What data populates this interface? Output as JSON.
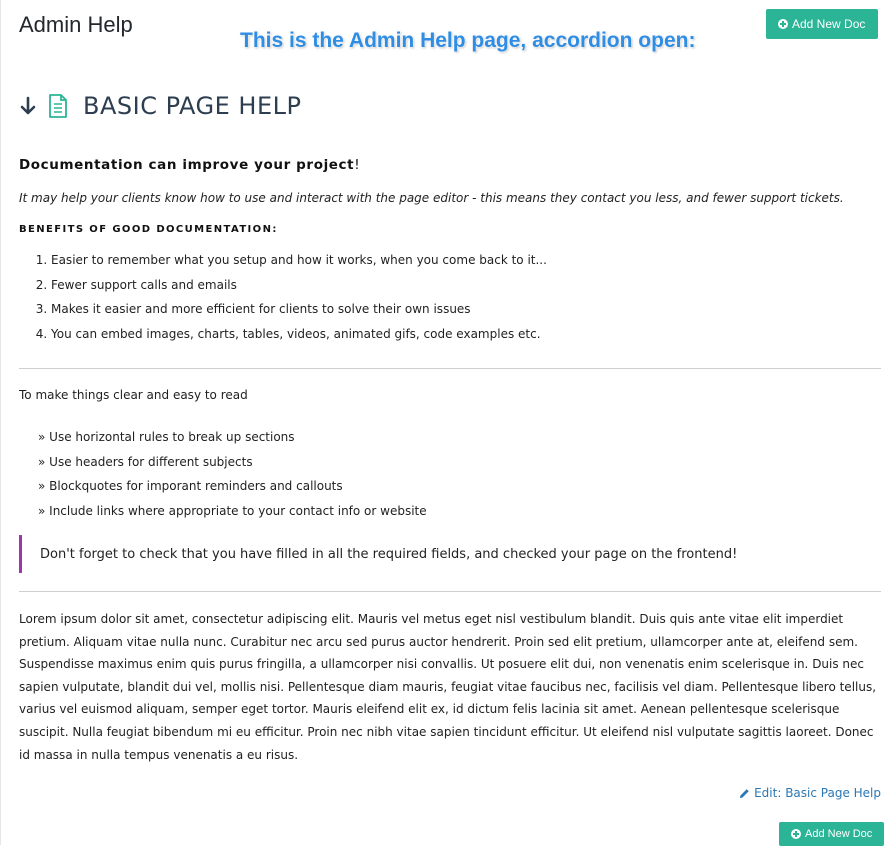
{
  "header": {
    "title": "Admin Help",
    "banner": "This is the Admin Help page, accordion open:",
    "add_button": "Add New Doc"
  },
  "accordion": {
    "title": "BASIC PAGE HELP",
    "icons": [
      "arrow-down-icon",
      "document-icon"
    ]
  },
  "doc": {
    "heading": "Documentation can improve your project",
    "heading_suffix": "!",
    "intro": "It may help your clients know how to use and interact with the page editor - this means they contact you less, and fewer support tickets.",
    "benefits_heading": "BENEFITS OF GOOD DOCUMENTATION:",
    "benefits": [
      "Easier to remember what you setup and how it works, when you come back to it...",
      "Fewer support calls and emails",
      "Makes it easier and more efficient for clients to solve their own issues",
      "You can embed images, charts, tables, videos, animated gifs, code examples etc."
    ],
    "clear_text": "To make things clear and easy to read",
    "tips": [
      "» Use horizontal rules to break up sections",
      "» Use headers for different subjects",
      "» Blockquotes for imporant reminders and callouts",
      "» Include links where appropriate to your contact info or website"
    ],
    "callout": "Don't forget to check that you have filled in all the required fields, and checked your page on the frontend!",
    "lorem": "Lorem ipsum dolor sit amet, consectetur adipiscing elit. Mauris vel metus eget nisl vestibulum blandit. Duis quis ante vitae elit imperdiet pretium. Aliquam vitae nulla nunc. Curabitur nec arcu sed purus auctor hendrerit. Proin sed elit pretium, ullamcorper ante at, eleifend sem. Suspendisse maximus enim quis purus fringilla, a ullamcorper nisi convallis. Ut posuere elit dui, non venenatis enim scelerisque in. Duis nec sapien vulputate, blandit dui vel, mollis nisi. Pellentesque diam mauris, feugiat vitae faucibus nec, facilisis vel diam. Pellentesque libero tellus, varius vel euismod aliquam, semper eget tortor. Mauris eleifend elit ex, id dictum felis lacinia sit amet. Aenean pellentesque scelerisque suscipit. Nulla feugiat bibendum mi eu efficitur. Proin nec nibh vitae sapien tincidunt efficitur. Ut eleifend nisl vulputate sagittis laoreet. Donec id massa in nulla tempus venenatis a eu risus."
  },
  "footer": {
    "edit_link": "Edit: Basic Page Help",
    "add_button": "Add New Doc"
  },
  "colors": {
    "accent": "#2bb596",
    "callout_border": "#9b37a6",
    "link": "#2a78b5",
    "banner": "#2f8de4"
  }
}
